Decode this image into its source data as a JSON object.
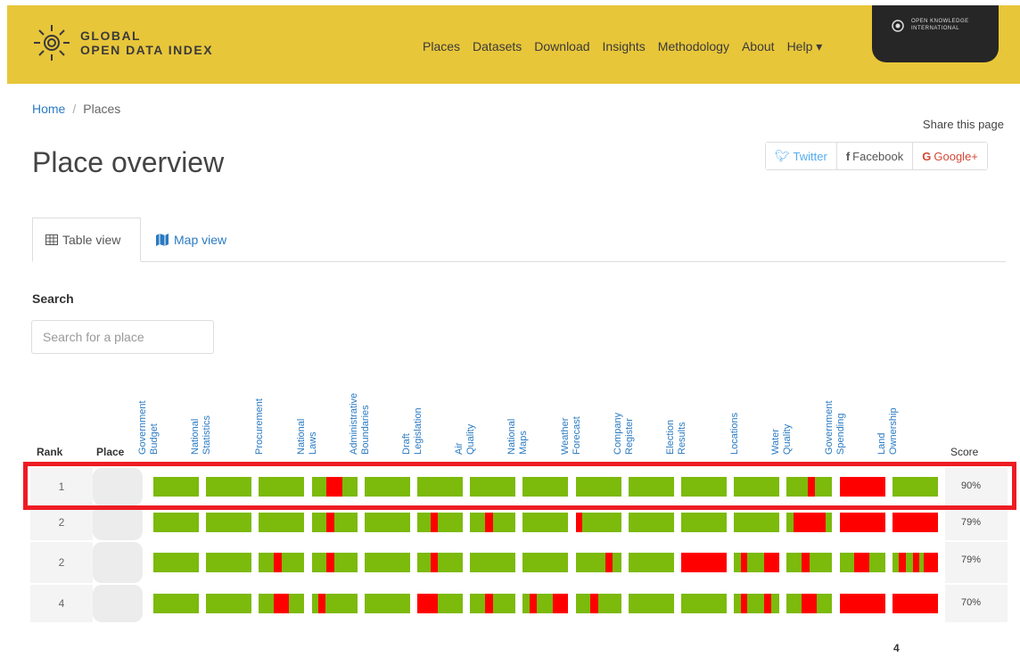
{
  "header": {
    "logo_line1": "GLOBAL",
    "logo_line2": "OPEN DATA INDEX",
    "nav": [
      "Places",
      "Datasets",
      "Download",
      "Insights",
      "Methodology",
      "About",
      "Help ▾"
    ],
    "badge_line1": "OPEN KNOWLEDGE",
    "badge_line2": "INTERNATIONAL"
  },
  "breadcrumb": {
    "home": "Home",
    "separator": "/",
    "current": "Places"
  },
  "share": {
    "label": "Share this page",
    "twitter": "Twitter",
    "facebook": "Facebook",
    "google": "Google+"
  },
  "page_title": "Place overview",
  "tabs": {
    "table": "Table view",
    "map": "Map view"
  },
  "search": {
    "label": "Search",
    "placeholder": "Search for a place"
  },
  "table": {
    "rank_header": "Rank",
    "place_header": "Place",
    "score_header": "Score",
    "datasets": [
      [
        "Government",
        "Budget"
      ],
      [
        "National",
        "Statistics"
      ],
      [
        "Procurement"
      ],
      [
        "National",
        "Laws"
      ],
      [
        "Administrative",
        "Boundaries"
      ],
      [
        "Draft",
        "Legislation"
      ],
      [
        "Air",
        "Quality"
      ],
      [
        "National",
        "Maps"
      ],
      [
        "Weather",
        "Forecast"
      ],
      [
        "Company",
        "Register"
      ],
      [
        "Election",
        "Results"
      ],
      [
        "Locations"
      ],
      [
        "Water",
        "Quality"
      ],
      [
        "Government",
        "Spending"
      ],
      [
        "Land",
        "Ownership"
      ]
    ],
    "rows": [
      {
        "rank": "1",
        "score": "90%",
        "red": [
          [],
          [],
          [],
          [
            [
              0.33,
              0.67
            ]
          ],
          [],
          [],
          [],
          [],
          [],
          [],
          [],
          [],
          [
            [
              0.46,
              0.62
            ]
          ],
          [
            [
              0,
              1
            ]
          ],
          []
        ]
      },
      {
        "rank": "2",
        "score": "79%",
        "red": [
          [],
          [],
          [],
          [
            [
              0.33,
              0.5
            ]
          ],
          [],
          [
            [
              0.3,
              0.45
            ]
          ],
          [
            [
              0.33,
              0.5
            ]
          ],
          [],
          [
            [
              0,
              0.15
            ]
          ],
          [],
          [],
          [],
          [
            [
              0.15,
              0.85
            ]
          ],
          [
            [
              0,
              1
            ]
          ],
          [
            [
              0,
              1
            ]
          ]
        ]
      },
      {
        "rank": "2",
        "score": "79%",
        "red": [
          [],
          [],
          [
            [
              0.33,
              0.5
            ]
          ],
          [
            [
              0.33,
              0.5
            ]
          ],
          [],
          [
            [
              0.3,
              0.45
            ]
          ],
          [],
          [],
          [
            [
              0.66,
              0.82
            ]
          ],
          [],
          [
            [
              0,
              1
            ]
          ],
          [
            [
              0.15,
              0.3
            ],
            [
              0.66,
              1
            ]
          ],
          [
            [
              0.33,
              0.5
            ]
          ],
          [
            [
              0.33,
              0.66
            ]
          ],
          [
            [
              0.15,
              0.3
            ],
            [
              0.45,
              0.6
            ],
            [
              0.7,
              1
            ]
          ]
        ]
      },
      {
        "rank": "4",
        "score": "70%",
        "red": [
          [],
          [],
          [
            [
              0.33,
              0.66
            ]
          ],
          [
            [
              0.15,
              0.3
            ]
          ],
          [],
          [
            [
              0,
              0.45
            ]
          ],
          [
            [
              0.33,
              0.5
            ]
          ],
          [
            [
              0.15,
              0.3
            ],
            [
              0.66,
              1
            ]
          ],
          [
            [
              0.33,
              0.5
            ]
          ],
          [],
          [],
          [
            [
              0.15,
              0.3
            ],
            [
              0.66,
              0.82
            ]
          ],
          [
            [
              0.33,
              0.66
            ]
          ],
          [
            [
              0,
              1
            ]
          ],
          [
            [
              0,
              1
            ]
          ]
        ]
      }
    ]
  },
  "footnote": "4"
}
